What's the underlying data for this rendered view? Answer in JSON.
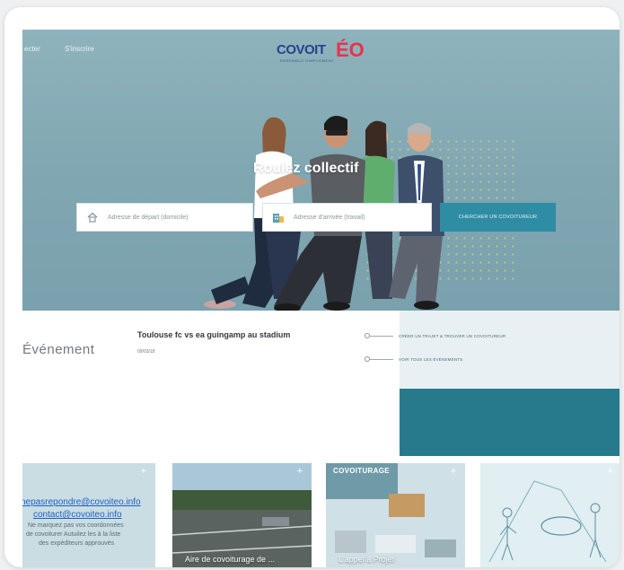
{
  "nav": {
    "login_label": "ecter",
    "signup_label": "S'inscrire"
  },
  "logo": {
    "main": "COVOIT",
    "accent": "ÉO",
    "tagline": "ENSEMBLE SIMPLEMENT"
  },
  "hero": {
    "title": "Roulez collectif",
    "departure": {
      "placeholder": "Adresse de départ (domicile)",
      "icon": "home-icon"
    },
    "arrival": {
      "placeholder": "Adresse d'arrivée (travail)",
      "icon": "building-icon"
    },
    "search_button": "CHERCHER UN COVOITUREUR"
  },
  "events": {
    "title": "Événement",
    "event_name": "Toulouse fc vs ea guingamp au stadium",
    "event_date": "09/03/18"
  },
  "links": {
    "create_trip": "CRÉER UN TRAJET & TROUVER UN COVOITUREUR",
    "all_events": "VOIR TOUS LES ÉVÈNEMENTS"
  },
  "cards": [
    {
      "plus": "+",
      "email_1": "nepasrepondre@covoiteo.info",
      "email_2": "contact@covoiteo.info",
      "line_1": "Ne marquez pas vos coordonnées",
      "line_2": "de covoiturer Autuilez les à la liste",
      "line_3": "des expéditeurs approuvés"
    },
    {
      "plus": "+",
      "caption": "Aire de covoiturage de ..."
    },
    {
      "plus": "+",
      "heading": "COVOITURAGE",
      "caption": "L'appel à Projet"
    },
    {
      "plus": "+"
    }
  ],
  "colors": {
    "accent_teal": "#2f8da3",
    "dark_teal": "#267a8c",
    "logo_blue": "#2b3f8c",
    "logo_red": "#e8334a"
  }
}
